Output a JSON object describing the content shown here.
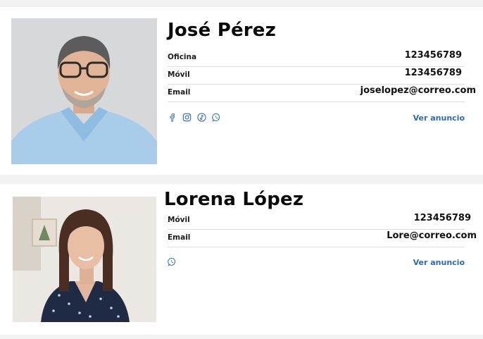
{
  "agents": [
    {
      "name": "José Pérez",
      "fields": [
        {
          "label": "Oficina",
          "value": "123456789"
        },
        {
          "label": "Móvil",
          "value": "123456789"
        },
        {
          "label": "Email",
          "value": "joselopez@correo.com"
        }
      ],
      "socials": [
        "facebook-icon",
        "instagram-icon",
        "tiktok-icon",
        "whatsapp-icon"
      ],
      "ad_link": "Ver anuncio"
    },
    {
      "name": "Lorena López",
      "fields": [
        {
          "label": "Móvil",
          "value": "123456789"
        },
        {
          "label": "Email",
          "value": "Lore@correo.com"
        }
      ],
      "socials": [
        "whatsapp-icon"
      ],
      "ad_link": "Ver anuncio"
    }
  ],
  "colors": {
    "link": "#2a6bb5",
    "social_icons": "#2a6bb5",
    "divider": "#dcdcdc",
    "card_background": "#ffffff",
    "page_background": "#f2f2f2"
  }
}
